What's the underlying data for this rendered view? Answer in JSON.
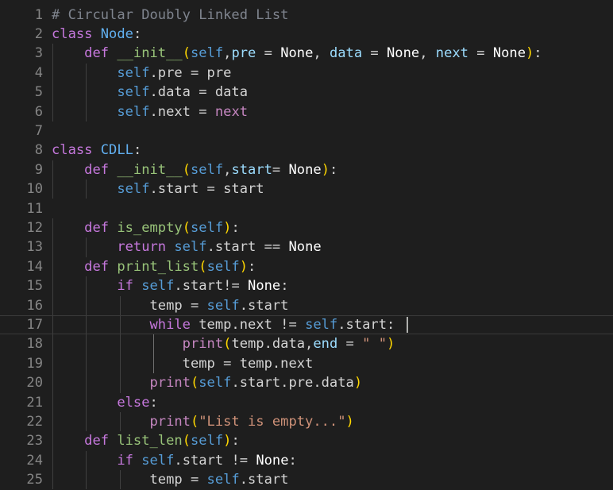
{
  "editor": {
    "language": "python",
    "current_line": 17,
    "colors": {
      "background": "#1e1e1e",
      "keyword": "#c678dd",
      "self": "#569cd6",
      "function": "#98c379",
      "string": "#ce9178",
      "comment": "#7f848e",
      "bracket": "#ffd700",
      "line_number": "#858585"
    },
    "lines": [
      {
        "n": "1",
        "tokens": [
          [
            "cmt",
            "# Circular Doubly Linked List"
          ]
        ]
      },
      {
        "n": "2",
        "tokens": [
          [
            "kw",
            "class"
          ],
          [
            "op",
            " "
          ],
          [
            "cls",
            "Node"
          ],
          [
            "op",
            ":"
          ]
        ]
      },
      {
        "n": "3",
        "tokens": [
          [
            "op",
            "    "
          ],
          [
            "kw",
            "def"
          ],
          [
            "op",
            " "
          ],
          [
            "fn",
            "__init__"
          ],
          [
            "br",
            "("
          ],
          [
            "slf",
            "self"
          ],
          [
            "op",
            ","
          ],
          [
            "par",
            "pre"
          ],
          [
            "op",
            " = "
          ],
          [
            "cons",
            "None"
          ],
          [
            "op",
            ", "
          ],
          [
            "par",
            "data"
          ],
          [
            "op",
            " = "
          ],
          [
            "cons",
            "None"
          ],
          [
            "op",
            ", "
          ],
          [
            "par",
            "next"
          ],
          [
            "op",
            " = "
          ],
          [
            "cons",
            "None"
          ],
          [
            "br",
            ")"
          ],
          [
            "op",
            ":"
          ]
        ]
      },
      {
        "n": "4",
        "tokens": [
          [
            "op",
            "        "
          ],
          [
            "slf",
            "self"
          ],
          [
            "op",
            ".pre = pre"
          ]
        ]
      },
      {
        "n": "5",
        "tokens": [
          [
            "op",
            "        "
          ],
          [
            "slf",
            "self"
          ],
          [
            "op",
            ".data = data"
          ]
        ]
      },
      {
        "n": "6",
        "tokens": [
          [
            "op",
            "        "
          ],
          [
            "slf",
            "self"
          ],
          [
            "op",
            ".next = "
          ],
          [
            "bi",
            "next"
          ]
        ]
      },
      {
        "n": "7",
        "tokens": []
      },
      {
        "n": "8",
        "tokens": [
          [
            "kw",
            "class"
          ],
          [
            "op",
            " "
          ],
          [
            "cls",
            "CDLL"
          ],
          [
            "op",
            ":"
          ]
        ]
      },
      {
        "n": "9",
        "tokens": [
          [
            "op",
            "    "
          ],
          [
            "kw",
            "def"
          ],
          [
            "op",
            " "
          ],
          [
            "fn",
            "__init__"
          ],
          [
            "br",
            "("
          ],
          [
            "slf",
            "self"
          ],
          [
            "op",
            ","
          ],
          [
            "par",
            "start"
          ],
          [
            "op",
            "= "
          ],
          [
            "cons",
            "None"
          ],
          [
            "br",
            ")"
          ],
          [
            "op",
            ":"
          ]
        ]
      },
      {
        "n": "10",
        "tokens": [
          [
            "op",
            "        "
          ],
          [
            "slf",
            "self"
          ],
          [
            "op",
            ".start = start"
          ]
        ]
      },
      {
        "n": "11",
        "tokens": []
      },
      {
        "n": "12",
        "tokens": [
          [
            "op",
            "    "
          ],
          [
            "kw",
            "def"
          ],
          [
            "op",
            " "
          ],
          [
            "fn",
            "is_empty"
          ],
          [
            "br",
            "("
          ],
          [
            "slf",
            "self"
          ],
          [
            "br",
            ")"
          ],
          [
            "op",
            ":"
          ]
        ]
      },
      {
        "n": "13",
        "tokens": [
          [
            "op",
            "        "
          ],
          [
            "kw",
            "return"
          ],
          [
            "op",
            " "
          ],
          [
            "slf",
            "self"
          ],
          [
            "op",
            ".start == "
          ],
          [
            "cons",
            "None"
          ]
        ]
      },
      {
        "n": "14",
        "tokens": [
          [
            "op",
            "    "
          ],
          [
            "kw",
            "def"
          ],
          [
            "op",
            " "
          ],
          [
            "fn",
            "print_list"
          ],
          [
            "br",
            "("
          ],
          [
            "slf",
            "self"
          ],
          [
            "br",
            ")"
          ],
          [
            "op",
            ":"
          ]
        ]
      },
      {
        "n": "15",
        "tokens": [
          [
            "op",
            "        "
          ],
          [
            "kw",
            "if"
          ],
          [
            "op",
            " "
          ],
          [
            "slf",
            "self"
          ],
          [
            "op",
            ".start!= "
          ],
          [
            "cons",
            "None"
          ],
          [
            "op",
            ":"
          ]
        ]
      },
      {
        "n": "16",
        "tokens": [
          [
            "op",
            "            temp = "
          ],
          [
            "slf",
            "self"
          ],
          [
            "op",
            ".start"
          ]
        ]
      },
      {
        "n": "17",
        "tokens": [
          [
            "op",
            "            "
          ],
          [
            "kw",
            "while"
          ],
          [
            "op",
            " temp.next != "
          ],
          [
            "slf",
            "self"
          ],
          [
            "op",
            ".start:"
          ]
        ]
      },
      {
        "n": "18",
        "tokens": [
          [
            "op",
            "                "
          ],
          [
            "bi",
            "print"
          ],
          [
            "br",
            "("
          ],
          [
            "op",
            "temp.data,"
          ],
          [
            "par",
            "end"
          ],
          [
            "op",
            " = "
          ],
          [
            "str",
            "\" \""
          ],
          [
            "br",
            ")"
          ]
        ]
      },
      {
        "n": "19",
        "tokens": [
          [
            "op",
            "                temp = temp.next"
          ]
        ]
      },
      {
        "n": "20",
        "tokens": [
          [
            "op",
            "            "
          ],
          [
            "bi",
            "print"
          ],
          [
            "br",
            "("
          ],
          [
            "slf",
            "self"
          ],
          [
            "op",
            ".start.pre.data"
          ],
          [
            "br",
            ")"
          ]
        ]
      },
      {
        "n": "21",
        "tokens": [
          [
            "op",
            "        "
          ],
          [
            "kw",
            "else"
          ],
          [
            "op",
            ":"
          ]
        ]
      },
      {
        "n": "22",
        "tokens": [
          [
            "op",
            "            "
          ],
          [
            "bi",
            "print"
          ],
          [
            "br",
            "("
          ],
          [
            "str",
            "\"List is empty...\""
          ],
          [
            "br",
            ")"
          ]
        ]
      },
      {
        "n": "23",
        "tokens": [
          [
            "op",
            "    "
          ],
          [
            "kw",
            "def"
          ],
          [
            "op",
            " "
          ],
          [
            "fn",
            "list_len"
          ],
          [
            "br",
            "("
          ],
          [
            "slf",
            "self"
          ],
          [
            "br",
            ")"
          ],
          [
            "op",
            ":"
          ]
        ]
      },
      {
        "n": "24",
        "tokens": [
          [
            "op",
            "        "
          ],
          [
            "kw",
            "if"
          ],
          [
            "op",
            " "
          ],
          [
            "slf",
            "self"
          ],
          [
            "op",
            ".start != "
          ],
          [
            "cons",
            "None"
          ],
          [
            "op",
            ":"
          ]
        ]
      },
      {
        "n": "25",
        "tokens": [
          [
            "op",
            "            temp = "
          ],
          [
            "slf",
            "self"
          ],
          [
            "op",
            ".start"
          ]
        ]
      }
    ]
  }
}
